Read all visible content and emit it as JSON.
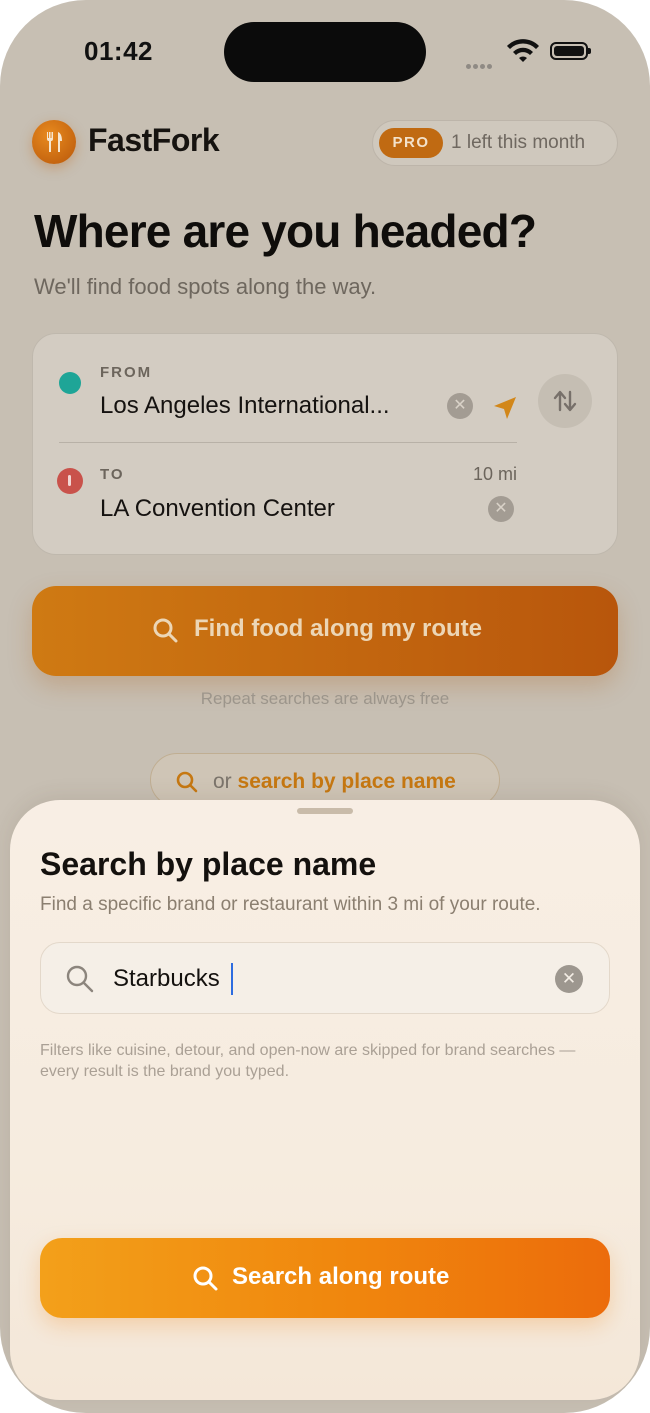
{
  "status_bar": {
    "time": "01:42"
  },
  "header": {
    "brand": "FastFork",
    "pro_badge": "PRO",
    "pro_text": "1 left this month"
  },
  "hero": {
    "title": "Where are you headed?",
    "subtitle": "We'll find food spots along the way."
  },
  "route": {
    "from_label": "FROM",
    "from_value": "Los Angeles International...",
    "to_label": "TO",
    "to_value": "LA Convention Center",
    "distance": "10 mi"
  },
  "find_button": {
    "label": "Find food along my route"
  },
  "repeat_note": "Repeat searches are always free",
  "alt_search": {
    "prefix": "or",
    "link": "search by place name"
  },
  "sheet": {
    "title": "Search by place name",
    "subtitle": "Find a specific brand or restaurant within 3 mi of your route.",
    "search_value": "Starbucks",
    "note": "Filters like cuisine, detour, and open-now are skipped for brand searches — every result is the brand you typed.",
    "button": "Search along route"
  },
  "colors": {
    "accent": "#f0860d",
    "brand_orange": "#c06a12",
    "from_dot": "#1ea597",
    "to_dot": "#c9524b"
  }
}
